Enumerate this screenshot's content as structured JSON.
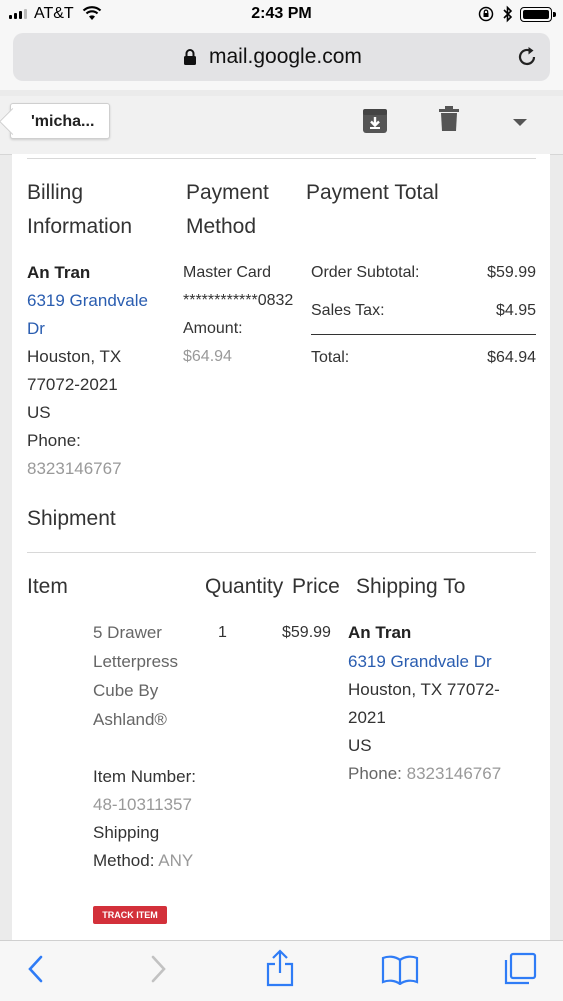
{
  "status_bar": {
    "carrier": "AT&T",
    "time": "2:43 PM"
  },
  "browser": {
    "url": "mail.google.com"
  },
  "toolbar": {
    "back_label": "'micha..."
  },
  "billing": {
    "header_billing": "Billing Information",
    "header_payment_method": "Payment Method",
    "header_payment_total": "Payment Total",
    "name": "An Tran",
    "street": "6319 Grandvale Dr",
    "city": "Houston, TX",
    "zip": "77072-2021",
    "country": "US",
    "phone_label": "Phone:",
    "phone": "8323146767",
    "card_type": "Master Card",
    "card_number": "************0832",
    "amount_label": "Amount:",
    "amount": "$64.94",
    "subtotal_label": "Order Subtotal:",
    "subtotal": "$59.99",
    "tax_label": "Sales Tax:",
    "tax": "$4.95",
    "total_label": "Total:",
    "total": "$64.94"
  },
  "shipment": {
    "title": "Shipment",
    "col_item": "Item",
    "col_quantity": "Quantity",
    "col_price": "Price",
    "col_shipping_to": "Shipping To",
    "item_name_1": "5 Drawer",
    "item_name_2": "Letterpress",
    "item_name_3": "Cube By",
    "item_name_4": "Ashland®",
    "quantity": "1",
    "price": "$59.99",
    "item_number_label": "Item Number:",
    "item_number": "48-10311357",
    "shipping_label_1": "Shipping",
    "shipping_label_2": "Method:",
    "shipping_method": "ANY",
    "track_button": "TRACK ITEM",
    "ship_name": "An Tran",
    "ship_street": "6319 Grandvale Dr",
    "ship_city": "Houston, TX 77072-",
    "ship_zip": "2021",
    "ship_country": "US",
    "ship_phone_label": "Phone:",
    "ship_phone": "8323146767"
  },
  "icons": [
    "wifi-icon",
    "rotation-lock-icon",
    "bluetooth-icon",
    "battery-icon",
    "lock-icon",
    "reload-icon",
    "archive-icon",
    "trash-icon",
    "dropdown-icon",
    "back-icon",
    "forward-icon",
    "share-icon",
    "bookmarks-icon",
    "tabs-icon"
  ],
  "colors": {
    "link": "#2a5db0",
    "track_button": "#d3303a",
    "safari_blue": "#2f7cf6"
  }
}
